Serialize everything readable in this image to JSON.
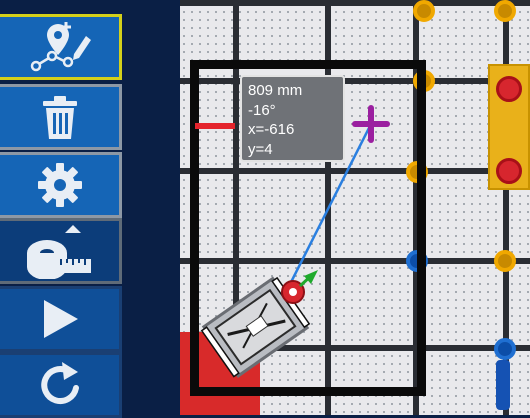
{
  "toolbar": {
    "buttons": [
      {
        "name": "path-edit",
        "icon": "path-edit-icon",
        "selected": true
      },
      {
        "name": "delete",
        "icon": "trash-icon"
      },
      {
        "name": "settings",
        "icon": "gear-icon"
      },
      {
        "name": "measure",
        "icon": "tape-measure-icon",
        "has_popup_arrow": true
      },
      {
        "name": "play",
        "icon": "play-icon"
      },
      {
        "name": "reset",
        "icon": "reset-icon"
      }
    ]
  },
  "measurement": {
    "distance": "809 mm",
    "angle": "-16°",
    "x": "x=-616",
    "y": "y=4"
  },
  "colors": {
    "toolbar_button": "#1565b6",
    "selected_border": "#d4d01a",
    "measure_line": "#2a7fe0",
    "target_marker": "#9b1fa0",
    "field": "#e9e9ec",
    "grid_line": "#2a2d33",
    "post_yellow": "#f0a800",
    "post_blue": "#1f6fd1"
  }
}
